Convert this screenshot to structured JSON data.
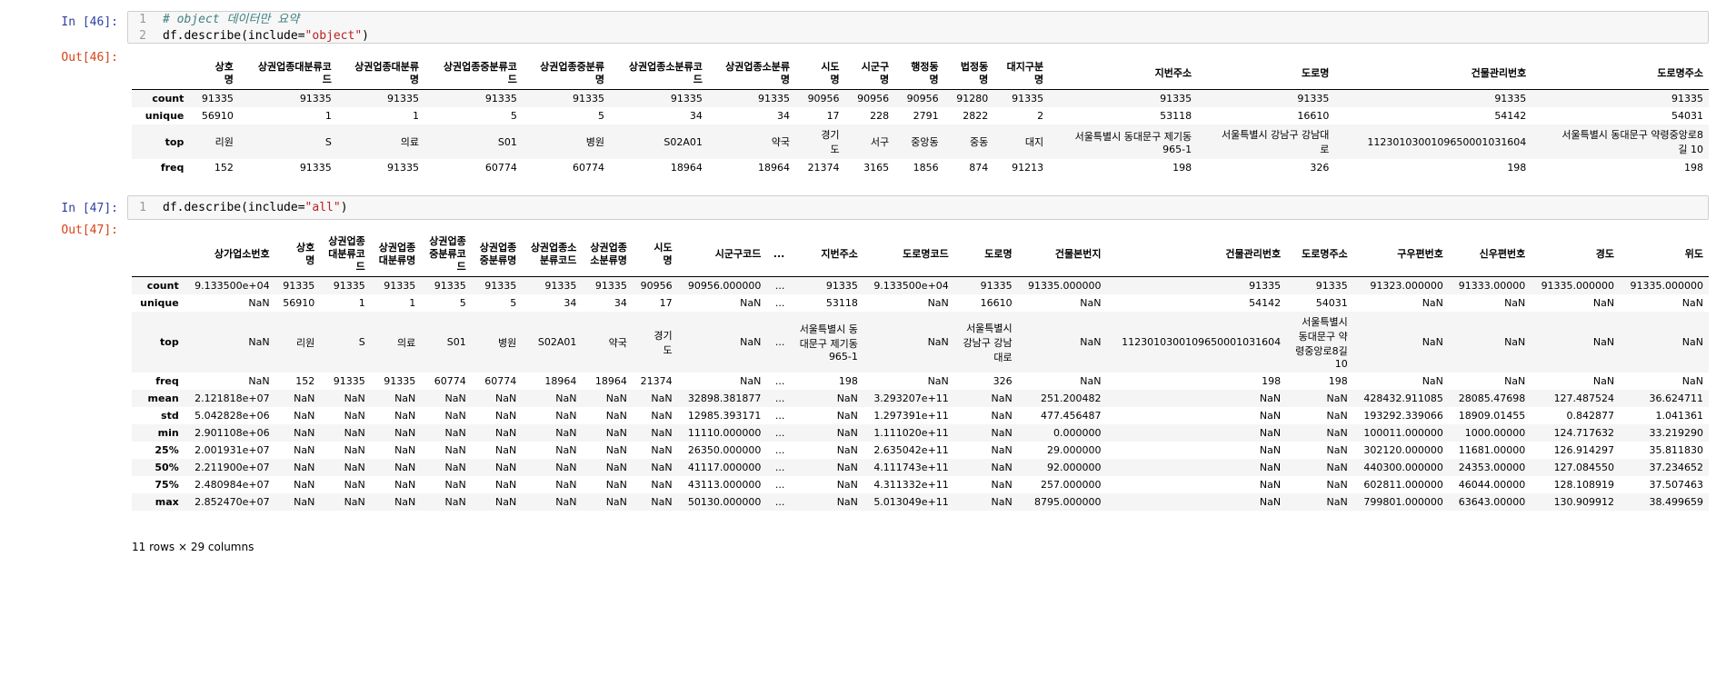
{
  "cells": [
    {
      "in_prompt": "In [46]:",
      "out_prompt": "Out[46]:",
      "code": [
        {
          "n": "1",
          "parts": [
            {
              "t": "comment",
              "v": "# object 데이터만 요약"
            }
          ]
        },
        {
          "n": "2",
          "parts": [
            {
              "t": "plain",
              "v": "df.describe(include="
            },
            {
              "t": "str",
              "v": "\"object\""
            },
            {
              "t": "plain",
              "v": ")"
            }
          ]
        }
      ],
      "columns": [
        "상호\n명",
        "상권업종대분류코\n드",
        "상권업종대분류\n명",
        "상권업종중분류코\n드",
        "상권업종중분류\n명",
        "상권업종소분류코\n드",
        "상권업종소분류\n명",
        "시도\n명",
        "시군구\n명",
        "행정동\n명",
        "법정동\n명",
        "대지구분\n명",
        "지번주소",
        "도로명",
        "건물관리번호",
        "도로명주소"
      ],
      "rows": [
        {
          "label": "count",
          "values": [
            "91335",
            "91335",
            "91335",
            "91335",
            "91335",
            "91335",
            "91335",
            "90956",
            "90956",
            "90956",
            "91280",
            "91335",
            "91335",
            "91335",
            "91335",
            "91335"
          ]
        },
        {
          "label": "unique",
          "values": [
            "56910",
            "1",
            "1",
            "5",
            "5",
            "34",
            "34",
            "17",
            "228",
            "2791",
            "2822",
            "2",
            "53118",
            "16610",
            "54142",
            "54031"
          ]
        },
        {
          "label": "top",
          "values": [
            "리원",
            "S",
            "의료",
            "S01",
            "병원",
            "S02A01",
            "약국",
            "경기\n도",
            "서구",
            "중앙동",
            "중동",
            "대지",
            "서울특별시 동대문구 제기동\n965-1",
            "서울특별시 강남구 강남대\n로",
            "1123010300109650001031604",
            "서울특별시 동대문구 약령중앙로8\n길 10"
          ]
        },
        {
          "label": "freq",
          "values": [
            "152",
            "91335",
            "91335",
            "60774",
            "60774",
            "18964",
            "18964",
            "21374",
            "3165",
            "1856",
            "874",
            "91213",
            "198",
            "326",
            "198",
            "198"
          ]
        }
      ]
    },
    {
      "in_prompt": "In [47]:",
      "out_prompt": "Out[47]:",
      "code": [
        {
          "n": "1",
          "parts": [
            {
              "t": "plain",
              "v": "df.describe(include="
            },
            {
              "t": "str",
              "v": "\"all\""
            },
            {
              "t": "plain",
              "v": ")"
            }
          ]
        }
      ],
      "columns": [
        "상가업소번호",
        "상호\n명",
        "상권업종\n대분류코\n드",
        "상권업종\n대분류명",
        "상권업종\n중분류코\n드",
        "상권업종\n중분류명",
        "상권업종소\n분류코드",
        "상권업종\n소분류명",
        "시도\n명",
        "시군구코드",
        "...",
        "지번주소",
        "도로명코드",
        "도로명",
        "건물본번지",
        "건물관리번호",
        "도로명주소",
        "구우편번호",
        "신우편번호",
        "경도",
        "위도"
      ],
      "rows": [
        {
          "label": "count",
          "values": [
            "9.133500e+04",
            "91335",
            "91335",
            "91335",
            "91335",
            "91335",
            "91335",
            "91335",
            "90956",
            "90956.000000",
            "...",
            "91335",
            "9.133500e+04",
            "91335",
            "91335.000000",
            "91335",
            "91335",
            "91323.000000",
            "91333.00000",
            "91335.000000",
            "91335.000000"
          ]
        },
        {
          "label": "unique",
          "values": [
            "NaN",
            "56910",
            "1",
            "1",
            "5",
            "5",
            "34",
            "34",
            "17",
            "NaN",
            "...",
            "53118",
            "NaN",
            "16610",
            "NaN",
            "54142",
            "54031",
            "NaN",
            "NaN",
            "NaN",
            "NaN"
          ]
        },
        {
          "label": "top",
          "values": [
            "NaN",
            "리원",
            "S",
            "의료",
            "S01",
            "병원",
            "S02A01",
            "약국",
            "경기\n도",
            "NaN",
            "...",
            "서울특별시 동\n대문구 제기동\n965-1",
            "NaN",
            "서울특별시\n강남구 강남\n대로",
            "NaN",
            "1123010300109650001031604",
            "서울특별시\n동대문구 약\n령중앙로8길\n10",
            "NaN",
            "NaN",
            "NaN",
            "NaN"
          ]
        },
        {
          "label": "freq",
          "values": [
            "NaN",
            "152",
            "91335",
            "91335",
            "60774",
            "60774",
            "18964",
            "18964",
            "21374",
            "NaN",
            "...",
            "198",
            "NaN",
            "326",
            "NaN",
            "198",
            "198",
            "NaN",
            "NaN",
            "NaN",
            "NaN"
          ]
        },
        {
          "label": "mean",
          "values": [
            "2.121818e+07",
            "NaN",
            "NaN",
            "NaN",
            "NaN",
            "NaN",
            "NaN",
            "NaN",
            "NaN",
            "32898.381877",
            "...",
            "NaN",
            "3.293207e+11",
            "NaN",
            "251.200482",
            "NaN",
            "NaN",
            "428432.911085",
            "28085.47698",
            "127.487524",
            "36.624711"
          ]
        },
        {
          "label": "std",
          "values": [
            "5.042828e+06",
            "NaN",
            "NaN",
            "NaN",
            "NaN",
            "NaN",
            "NaN",
            "NaN",
            "NaN",
            "12985.393171",
            "...",
            "NaN",
            "1.297391e+11",
            "NaN",
            "477.456487",
            "NaN",
            "NaN",
            "193292.339066",
            "18909.01455",
            "0.842877",
            "1.041361"
          ]
        },
        {
          "label": "min",
          "values": [
            "2.901108e+06",
            "NaN",
            "NaN",
            "NaN",
            "NaN",
            "NaN",
            "NaN",
            "NaN",
            "NaN",
            "11110.000000",
            "...",
            "NaN",
            "1.111020e+11",
            "NaN",
            "0.000000",
            "NaN",
            "NaN",
            "100011.000000",
            "1000.00000",
            "124.717632",
            "33.219290"
          ]
        },
        {
          "label": "25%",
          "values": [
            "2.001931e+07",
            "NaN",
            "NaN",
            "NaN",
            "NaN",
            "NaN",
            "NaN",
            "NaN",
            "NaN",
            "26350.000000",
            "...",
            "NaN",
            "2.635042e+11",
            "NaN",
            "29.000000",
            "NaN",
            "NaN",
            "302120.000000",
            "11681.00000",
            "126.914297",
            "35.811830"
          ]
        },
        {
          "label": "50%",
          "values": [
            "2.211900e+07",
            "NaN",
            "NaN",
            "NaN",
            "NaN",
            "NaN",
            "NaN",
            "NaN",
            "NaN",
            "41117.000000",
            "...",
            "NaN",
            "4.111743e+11",
            "NaN",
            "92.000000",
            "NaN",
            "NaN",
            "440300.000000",
            "24353.00000",
            "127.084550",
            "37.234652"
          ]
        },
        {
          "label": "75%",
          "values": [
            "2.480984e+07",
            "NaN",
            "NaN",
            "NaN",
            "NaN",
            "NaN",
            "NaN",
            "NaN",
            "NaN",
            "43113.000000",
            "...",
            "NaN",
            "4.311332e+11",
            "NaN",
            "257.000000",
            "NaN",
            "NaN",
            "602811.000000",
            "46044.00000",
            "128.108919",
            "37.507463"
          ]
        },
        {
          "label": "max",
          "values": [
            "2.852470e+07",
            "NaN",
            "NaN",
            "NaN",
            "NaN",
            "NaN",
            "NaN",
            "NaN",
            "NaN",
            "50130.000000",
            "...",
            "NaN",
            "5.013049e+11",
            "NaN",
            "8795.000000",
            "NaN",
            "NaN",
            "799801.000000",
            "63643.00000",
            "130.909912",
            "38.499659"
          ]
        }
      ],
      "footer": "11 rows × 29 columns"
    }
  ]
}
